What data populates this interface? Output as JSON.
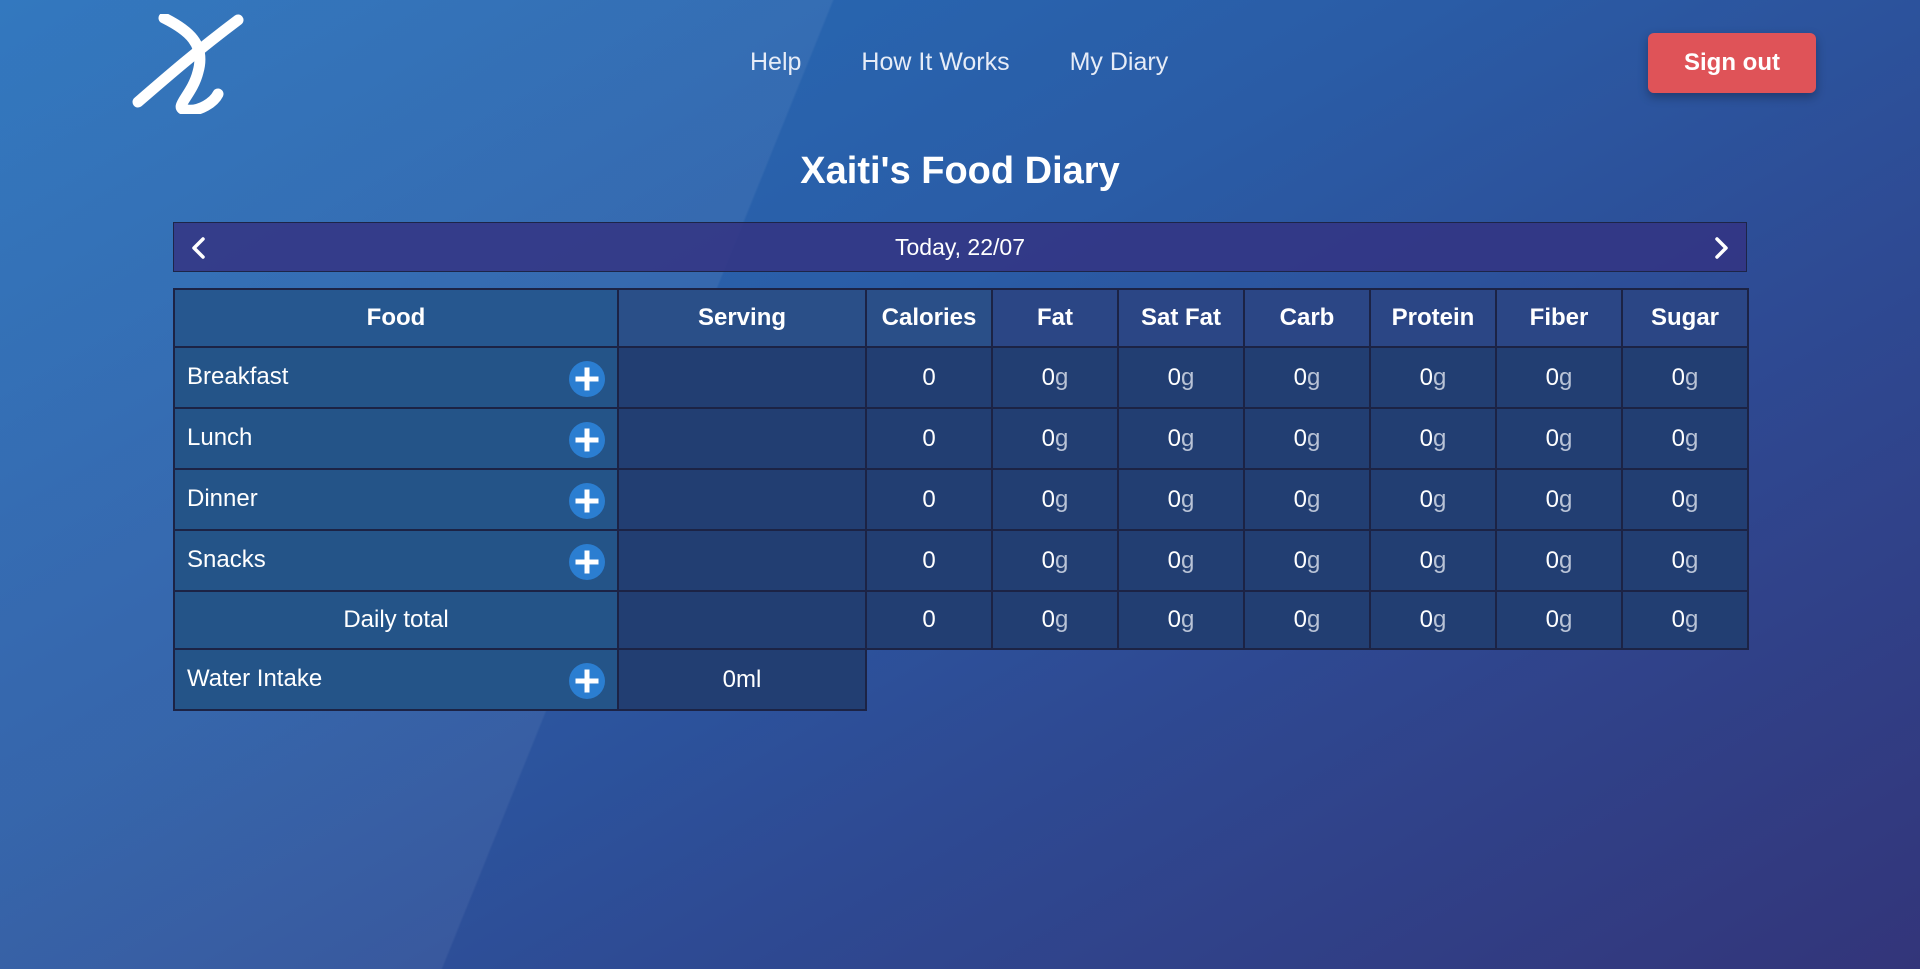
{
  "nav": {
    "links": [
      "Help",
      "How It Works",
      "My Diary"
    ],
    "signout_label": "Sign out"
  },
  "page": {
    "title": "Xaiti's Food Diary"
  },
  "date_nav": {
    "label": "Today, 22/07",
    "prev_icon": "chevron-left-icon",
    "next_icon": "chevron-right-icon"
  },
  "table": {
    "headers": [
      "Food",
      "Serving",
      "Calories",
      "Fat",
      "Sat Fat",
      "Carb",
      "Protein",
      "Fiber",
      "Sugar"
    ],
    "unit": "g",
    "meals": [
      {
        "name": "Breakfast",
        "calories": "0",
        "fat": "0",
        "sat_fat": "0",
        "carb": "0",
        "protein": "0",
        "fiber": "0",
        "sugar": "0"
      },
      {
        "name": "Lunch",
        "calories": "0",
        "fat": "0",
        "sat_fat": "0",
        "carb": "0",
        "protein": "0",
        "fiber": "0",
        "sugar": "0"
      },
      {
        "name": "Dinner",
        "calories": "0",
        "fat": "0",
        "sat_fat": "0",
        "carb": "0",
        "protein": "0",
        "fiber": "0",
        "sugar": "0"
      },
      {
        "name": "Snacks",
        "calories": "0",
        "fat": "0",
        "sat_fat": "0",
        "carb": "0",
        "protein": "0",
        "fiber": "0",
        "sugar": "0"
      }
    ],
    "total": {
      "label": "Daily total",
      "calories": "0",
      "fat": "0",
      "sat_fat": "0",
      "carb": "0",
      "protein": "0",
      "fiber": "0",
      "sugar": "0"
    },
    "water": {
      "label": "Water Intake",
      "value": "0ml"
    }
  },
  "colors": {
    "accent": "#2b7ed1",
    "signout": "#df5358",
    "border": "#1c2345"
  }
}
